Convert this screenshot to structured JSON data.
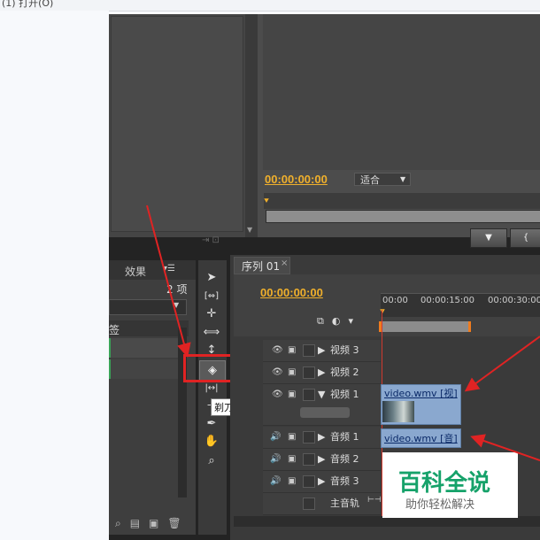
{
  "window": {
    "title_fragment": "(1)    打开(O)"
  },
  "source_monitor": {},
  "program_monitor": {
    "timecode": "00:00:00:00",
    "fit_select": "适合",
    "buttons": [
      "▼",
      "{"
    ]
  },
  "project_panel": {
    "tab_effects": "效果",
    "item_count": "2 项",
    "col_label": "签"
  },
  "tools": {
    "tooltip": "剃刀工具 (C)",
    "items": [
      "selection-tool",
      "track-select-tool",
      "ripple-edit-tool",
      "rolling-edit-tool",
      "rate-stretch-tool",
      "razor-tool",
      "slip-tool",
      "slide-tool",
      "pen-tool",
      "hand-tool",
      "zoom-tool"
    ]
  },
  "timeline": {
    "tab_label": "序列 01",
    "timecode": "00:00:00:00",
    "ruler": [
      "00:00",
      "00:00:15:00",
      "00:00:30:00"
    ],
    "tracks": [
      {
        "name": "视频 3",
        "kind": "video"
      },
      {
        "name": "视频 2",
        "kind": "video"
      },
      {
        "name": "视频 1",
        "kind": "video"
      },
      {
        "name": "音频 1",
        "kind": "audio"
      },
      {
        "name": "音频 2",
        "kind": "audio"
      },
      {
        "name": "音频 3",
        "kind": "audio"
      },
      {
        "name": "主音轨",
        "kind": "master"
      }
    ],
    "clips": {
      "video": "video.wmv [视]",
      "audio": "video.wmv [音]"
    }
  },
  "watermark": {
    "title": "百科全说",
    "subtitle": "助你轻松解决"
  },
  "colors": {
    "accent": "#f0b02c",
    "highlight": "#e02323",
    "clip": "#8aa8cf"
  }
}
